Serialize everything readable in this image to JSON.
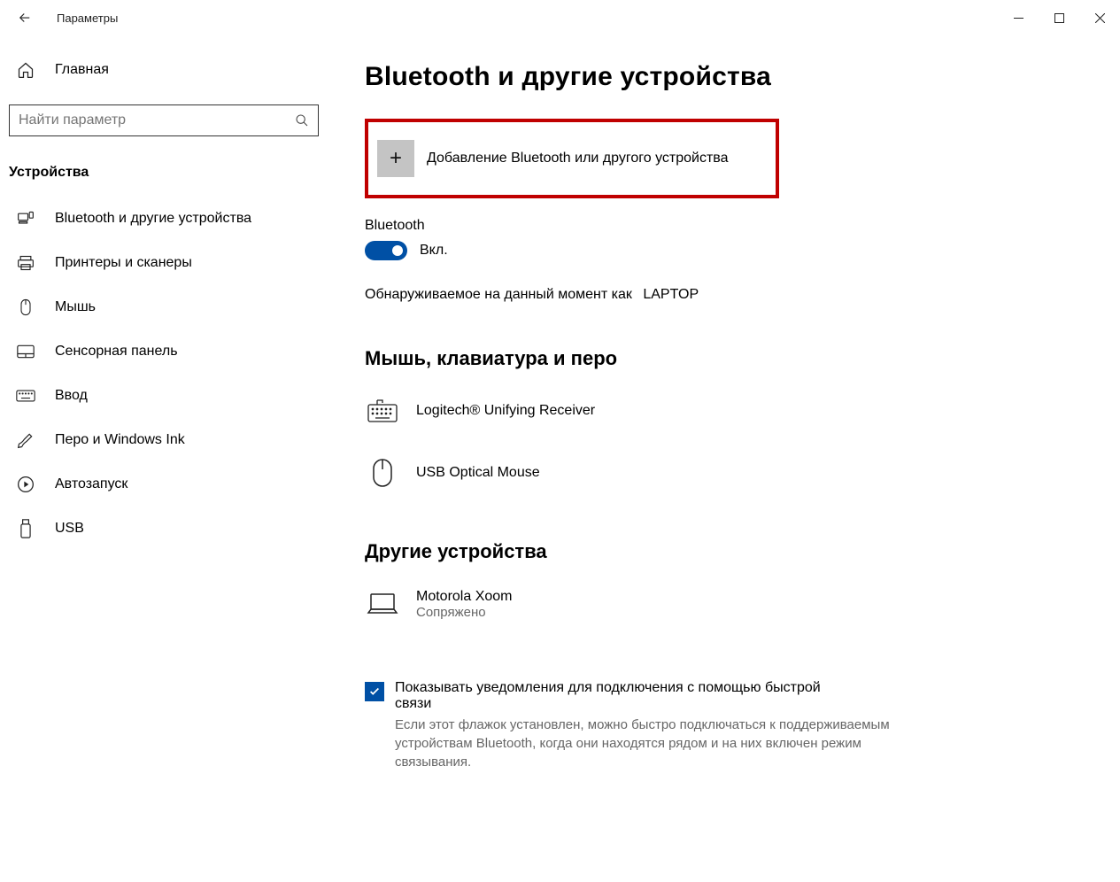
{
  "titlebar": {
    "app_title": "Параметры"
  },
  "sidebar": {
    "home_label": "Главная",
    "search_placeholder": "Найти параметр",
    "category": "Устройства",
    "items": [
      {
        "label": "Bluetooth и другие устройства"
      },
      {
        "label": "Принтеры и сканеры"
      },
      {
        "label": "Мышь"
      },
      {
        "label": "Сенсорная панель"
      },
      {
        "label": "Ввод"
      },
      {
        "label": "Перо и Windows Ink"
      },
      {
        "label": "Автозапуск"
      },
      {
        "label": "USB"
      }
    ]
  },
  "main": {
    "title": "Bluetooth и другие устройства",
    "add_device": "Добавление Bluetooth или другого устройства",
    "bt_label": "Bluetooth",
    "toggle_state": "Вкл.",
    "discoverable_prefix": "Обнаруживаемое на данный момент как",
    "discoverable_name": "LAPTOP",
    "section_input": "Мышь, клавиатура и перо",
    "devices_input": [
      {
        "name": "Logitech® Unifying Receiver"
      },
      {
        "name": "USB Optical Mouse"
      }
    ],
    "section_other": "Другие устройства",
    "devices_other": [
      {
        "name": "Motorola Xoom",
        "sub": "Сопряжено"
      }
    ],
    "quickpair_label": "Показывать уведомления для подключения с помощью быстрой связи",
    "quickpair_desc": "Если этот флажок установлен, можно быстро подключаться к поддерживаемым устройствам Bluetooth, когда они находятся рядом и на них включен режим связывания."
  }
}
